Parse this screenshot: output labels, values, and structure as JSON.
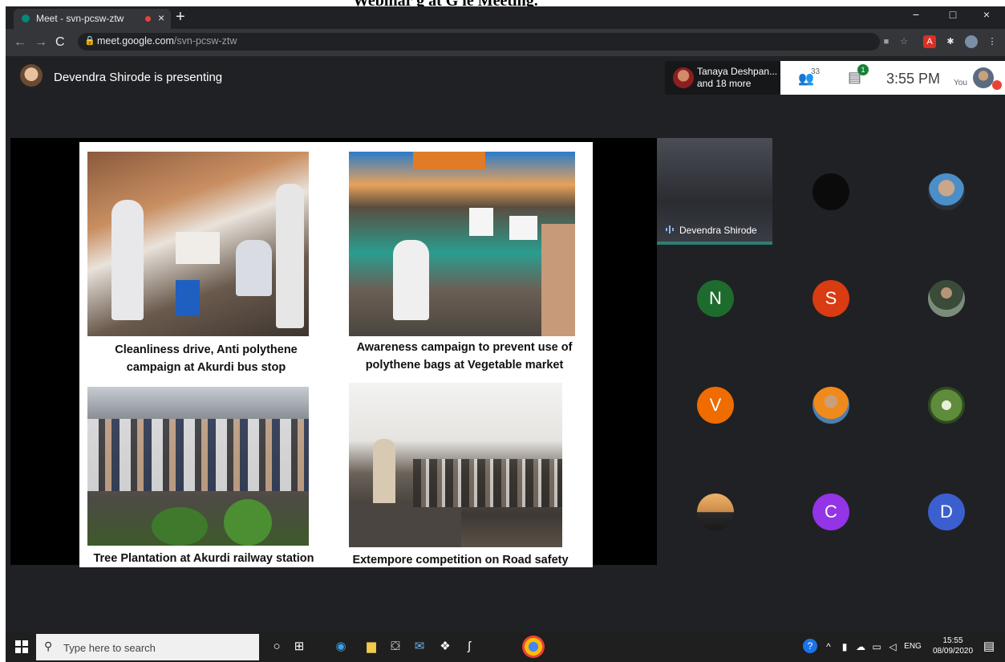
{
  "doc_caption": "Webinar g at  G  le Meeting.",
  "browser": {
    "tab_title": "Meet - svn-pcsw-ztw",
    "tab_close": "×",
    "new_tab": "+",
    "url_host": "meet.google.com",
    "url_path": "/svn-pcsw-ztw",
    "window_controls": [
      "−",
      "□",
      "×"
    ]
  },
  "meet": {
    "presenting_text": "Devendra Shirode is presenting",
    "participants_line1": "Tanaya Deshpan...",
    "participants_line2": "and 18 more",
    "people_count": "33",
    "chat_count": "1",
    "time": "3:55 PM",
    "you_label": "You"
  },
  "slide": {
    "captions": [
      "Cleanliness drive, Anti polythene campaign at Akurdi bus stop",
      "Awareness campaign to prevent use of polythene bags at Vegetable market",
      "Tree Plantation at Akurdi railway station",
      "Extempore competition on Road safety"
    ]
  },
  "tiles": {
    "self_name": "Devendra Shirode",
    "letters": [
      {
        "letter": "N",
        "color": "#1e6b2e"
      },
      {
        "letter": "S",
        "color": "#d93b12"
      },
      {
        "letter": "V",
        "color": "#ef6c00"
      },
      {
        "letter": "C",
        "color": "#9334e6"
      },
      {
        "letter": "D",
        "color": "#3c5fd0"
      }
    ]
  },
  "taskbar": {
    "search_placeholder": "Type here to search",
    "lang": "ENG",
    "time": "15:55",
    "date": "08/09/2020"
  }
}
